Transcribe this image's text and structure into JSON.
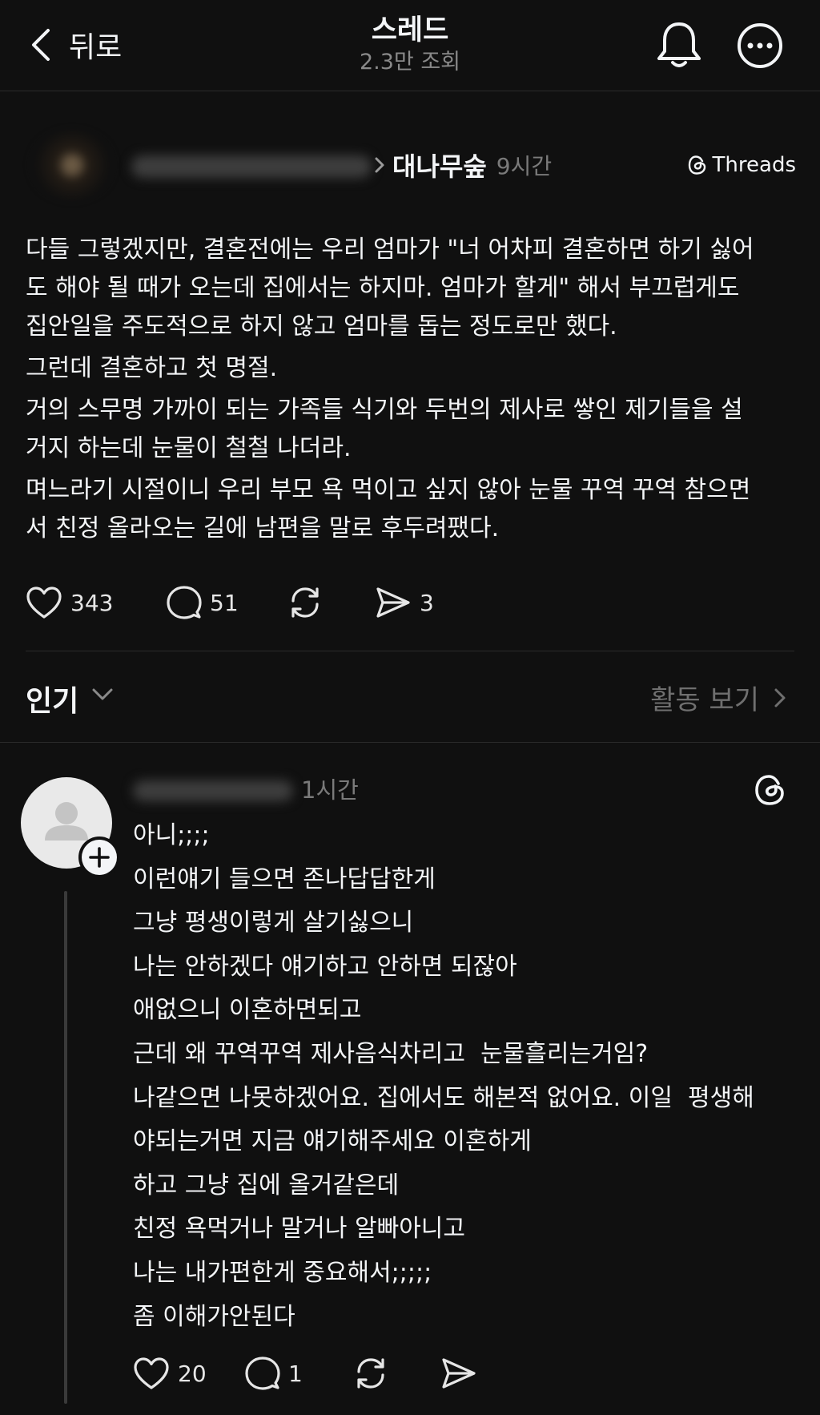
{
  "header": {
    "back_label": "뒤로",
    "title": "스레드",
    "views": "2.3만 조회"
  },
  "post": {
    "community": "대나무숲",
    "time": "9시간",
    "source_badge": "Threads",
    "paragraphs": [
      "다들 그렇겠지만, 결혼전에는 우리 엄마가 \"너 어차피 결혼하면 하기 싫어\n도 해야 될 때가 오는데 집에서는 하지마. 엄마가 할게\" 해서 부끄럽게도\n집안일을 주도적으로 하지 않고 엄마를 돕는 정도로만 했다.",
      "그런데 결혼하고 첫 명절.",
      "거의 스무명 가까이 되는 가족들 식기와 두번의 제사로 쌓인 제기들을 설\n거지 하는데 눈물이 철철 나더라.",
      "며느라기 시절이니 우리 부모 욕 먹이고 싶지 않아 눈물 꾸역 꾸역 참으면\n서 친정 올라오는 길에 남편을 말로 후두려팼다."
    ],
    "likes": "343",
    "comments": "51",
    "shares": "3"
  },
  "sort": {
    "label": "인기",
    "activity_label": "활동 보기"
  },
  "reply": {
    "time": "1시간",
    "lines": [
      "아니;;;;",
      "이런얘기 들으면 존나답답한게",
      "그냥 평생이렇게 살기싫으니",
      "나는 안하겠다 얘기하고 안하면 되잖아",
      "애없으니 이혼하면되고",
      "근데 왜 꾸역꾸역 제사음식차리고  눈물흘리는거임?",
      "나같으면 나못하겠어요. 집에서도 해본적 없어요. 이일  평생해",
      "야되는거면 지금 얘기해주세요 이혼하게",
      "하고 그냥 집에 올거같은데",
      "친정 욕먹거나 말거나 알빠아니고",
      "나는 내가편한게 중요해서;;;;;",
      "좀 이해가안된다"
    ],
    "likes": "20",
    "comments": "1"
  }
}
